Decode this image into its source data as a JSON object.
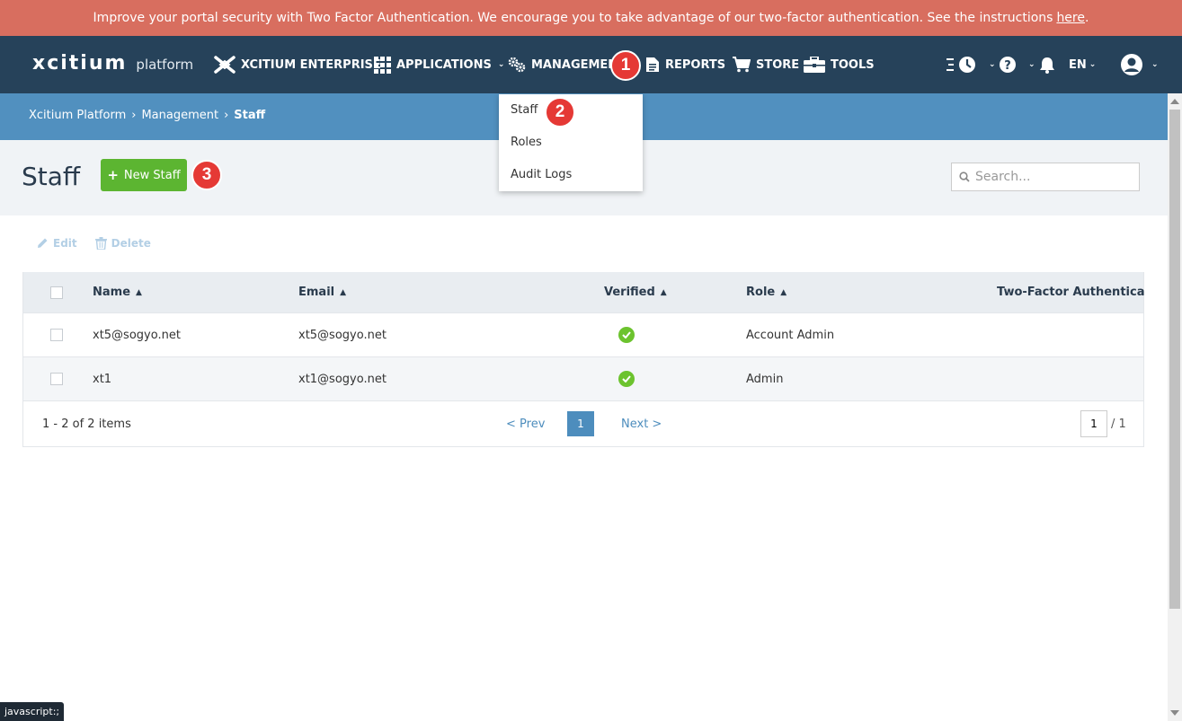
{
  "banner": {
    "text": "Improve your portal security with Two Factor Authentication. We encourage you to take advantage of our two-factor authentication. See the instructions",
    "link": "here",
    "suffix": "."
  },
  "nav": {
    "logo": "xcitium",
    "logo_sub": "platform",
    "items": [
      {
        "label": "XCITIUM ENTERPRISE"
      },
      {
        "label": "APPLICATIONS"
      },
      {
        "label": "MANAGEMENT"
      },
      {
        "label": "REPORTS"
      },
      {
        "label": "STORE"
      },
      {
        "label": "TOOLS"
      }
    ],
    "language": "EN"
  },
  "breadcrumb": [
    "Xcitium Platform",
    "Management",
    "Staff"
  ],
  "dropdown": [
    "Staff",
    "Roles",
    "Audit Logs"
  ],
  "badges": [
    "1",
    "2",
    "3"
  ],
  "header": {
    "title": "Staff",
    "new_button": "New Staff",
    "search_placeholder": "Search..."
  },
  "toolbar": {
    "edit": "Edit",
    "delete": "Delete"
  },
  "table": {
    "columns": [
      "Name",
      "Email",
      "Verified",
      "Role",
      "Two-Factor Authentication"
    ],
    "rows": [
      {
        "name": "xt5@sogyo.net",
        "email": "xt5@sogyo.net",
        "verified": true,
        "role": "Account Admin"
      },
      {
        "name": "xt1",
        "email": "xt1@sogyo.net",
        "verified": true,
        "role": "Admin"
      }
    ],
    "summary": "1 - 2 of 2 items",
    "prev": "< Prev",
    "next": "Next >",
    "current_page": "1",
    "page_input": "1",
    "total_pages": "/ 1"
  },
  "status_bar": "javascript:;",
  "colors": {
    "banner": "#d86e5f",
    "nav": "#26425a",
    "breadcrumb": "#5190bf",
    "primary_button": "#5cb531",
    "badge": "#e53935",
    "verified": "#6cc32e"
  }
}
